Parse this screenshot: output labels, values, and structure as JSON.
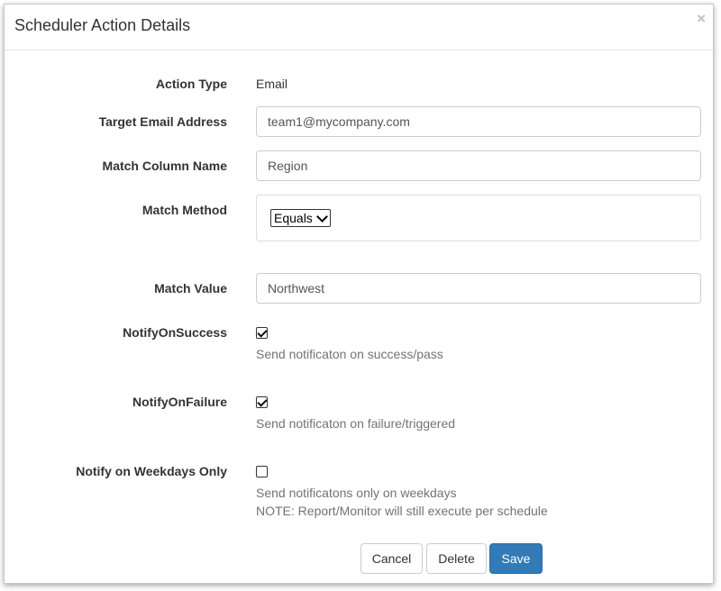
{
  "dialog": {
    "title": "Scheduler Action Details",
    "close_symbol": "×"
  },
  "form": {
    "action_type": {
      "label": "Action Type",
      "value": "Email"
    },
    "target_email": {
      "label": "Target Email Address",
      "value": "team1@mycompany.com"
    },
    "match_column": {
      "label": "Match Column Name",
      "value": "Region"
    },
    "match_method": {
      "label": "Match Method",
      "selected": "Equals"
    },
    "match_value": {
      "label": "Match Value",
      "value": "Northwest"
    },
    "notify_success": {
      "label": "NotifyOnSuccess",
      "checked": true,
      "help": "Send notificaton on success/pass"
    },
    "notify_failure": {
      "label": "NotifyOnFailure",
      "checked": true,
      "help": "Send notificaton on failure/triggered"
    },
    "notify_weekdays": {
      "label": "Notify on Weekdays Only",
      "checked": false,
      "help_line1": "Send notificatons only on weekdays",
      "help_line2": "NOTE: Report/Monitor will still execute per schedule"
    }
  },
  "buttons": {
    "cancel": "Cancel",
    "delete": "Delete",
    "save": "Save"
  },
  "colors": {
    "primary": "#337ab7",
    "border": "#cccccc",
    "help_text": "#737373"
  }
}
